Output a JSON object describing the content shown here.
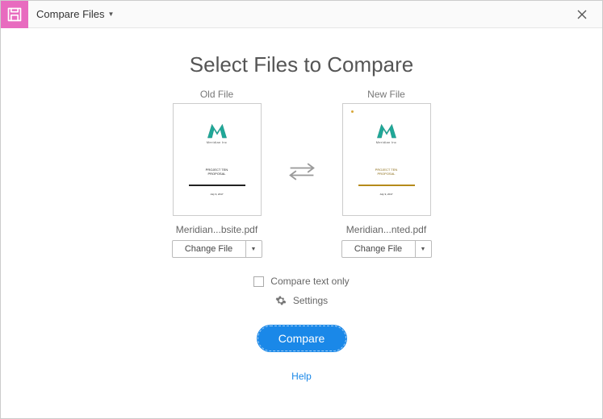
{
  "titlebar": {
    "menu_label": "Compare Files"
  },
  "heading": "Select Files to Compare",
  "old_file": {
    "label": "Old File",
    "filename": "Meridian...bsite.pdf",
    "change_label": "Change File",
    "logo_sub": "Meridian Inc",
    "line1a": "PROJECT TEN",
    "line1b": "PROPOSAL",
    "line3": "July 9, 2017"
  },
  "new_file": {
    "label": "New File",
    "filename": "Meridian...nted.pdf",
    "change_label": "Change File",
    "logo_sub": "Meridian Inc",
    "line1a": "PROJECT TEN",
    "line1b": "PROPOSAL",
    "line3": "July 9, 2017"
  },
  "options": {
    "compare_text_only": "Compare text only",
    "settings": "Settings"
  },
  "actions": {
    "compare": "Compare",
    "help": "Help"
  }
}
